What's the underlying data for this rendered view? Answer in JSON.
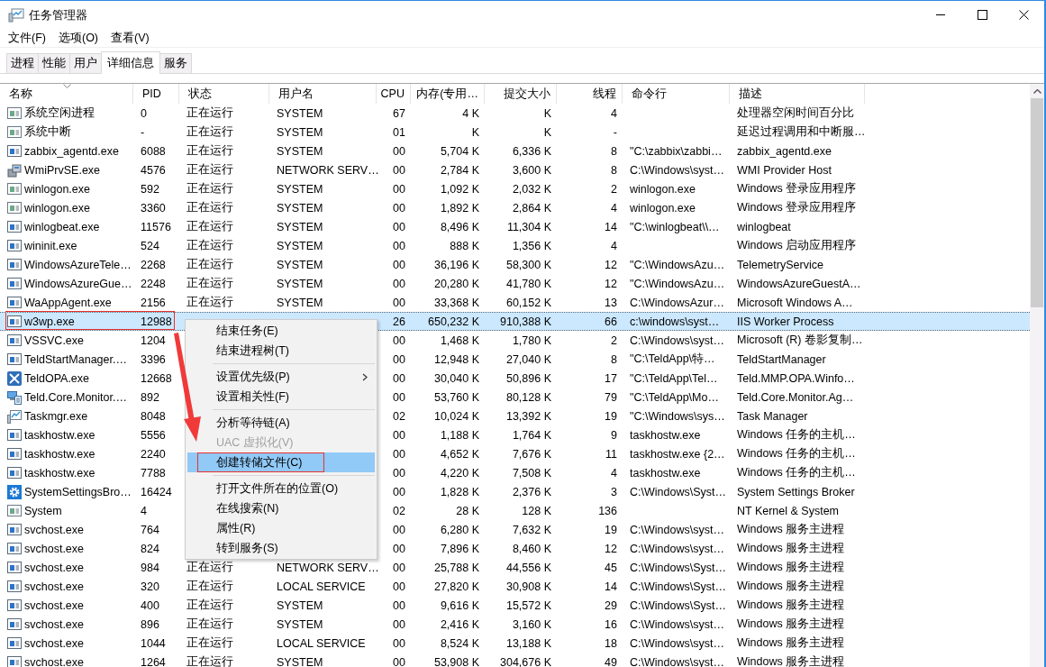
{
  "window": {
    "title": "任务管理器",
    "controls": [
      {
        "kind": "minimize"
      },
      {
        "kind": "maximize"
      },
      {
        "kind": "close"
      }
    ]
  },
  "menu_bar": [
    "文件(F)",
    "选项(O)",
    "查看(V)"
  ],
  "tabs": [
    {
      "label": "进程",
      "selected": false
    },
    {
      "label": "性能",
      "selected": false
    },
    {
      "label": "用户",
      "selected": false
    },
    {
      "label": "详细信息",
      "selected": true
    },
    {
      "label": "服务",
      "selected": false
    }
  ],
  "table": {
    "columns": [
      {
        "label": "名称",
        "sorted": true
      },
      {
        "label": "PID",
        "sorted": false
      },
      {
        "label": "状态",
        "sorted": false
      },
      {
        "label": "用户名",
        "sorted": false
      },
      {
        "label": "CPU",
        "sorted": false
      },
      {
        "label": "内存(专用…",
        "sorted": false
      },
      {
        "label": "提交大小",
        "sorted": false
      },
      {
        "label": "线程",
        "sorted": false
      },
      {
        "label": "命令行",
        "sorted": false
      },
      {
        "label": "描述",
        "sorted": false
      }
    ],
    "rows": [
      {
        "kind": "system",
        "name": "系统空闲进程",
        "pid": "0",
        "status": "正在运行",
        "user": "SYSTEM",
        "cpu": "67",
        "memory": "4 K",
        "commit": "K",
        "threads": "4",
        "description": "处理器空闲时间百分比",
        "selected": false,
        "outlined": false
      },
      {
        "kind": "system",
        "name": "系统中断",
        "pid": "-",
        "status": "正在运行",
        "user": "SYSTEM",
        "cpu": "01",
        "memory": "K",
        "commit": "K",
        "threads": "-",
        "description": "延迟过程调用和中断服…",
        "selected": false,
        "outlined": false
      },
      {
        "kind": "app",
        "name": "zabbix_agentd.exe",
        "pid": "6088",
        "status": "正在运行",
        "user": "SYSTEM",
        "cpu": "00",
        "memory": "5,704 K",
        "commit": "6,336 K",
        "threads": "8",
        "command": "\"C:\\zabbix\\zabbi…",
        "description": "zabbix_agentd.exe",
        "selected": false,
        "outlined": false
      },
      {
        "kind": "wmi",
        "name": "WmiPrvSE.exe",
        "pid": "4576",
        "status": "正在运行",
        "user": "NETWORK SERV…",
        "cpu": "00",
        "memory": "2,784 K",
        "commit": "3,600 K",
        "threads": "8",
        "command": "C:\\Windows\\syst…",
        "description": "WMI Provider Host",
        "selected": false,
        "outlined": false
      },
      {
        "kind": "system",
        "name": "winlogon.exe",
        "pid": "592",
        "status": "正在运行",
        "user": "SYSTEM",
        "cpu": "00",
        "memory": "1,092 K",
        "commit": "2,032 K",
        "threads": "2",
        "command": "winlogon.exe",
        "description": "Windows 登录应用程序",
        "selected": false,
        "outlined": false
      },
      {
        "kind": "system",
        "name": "winlogon.exe",
        "pid": "3360",
        "status": "正在运行",
        "user": "SYSTEM",
        "cpu": "00",
        "memory": "1,892 K",
        "commit": "2,864 K",
        "threads": "4",
        "command": "winlogon.exe",
        "description": "Windows 登录应用程序",
        "selected": false,
        "outlined": false
      },
      {
        "kind": "app",
        "name": "winlogbeat.exe",
        "pid": "11576",
        "status": "正在运行",
        "user": "SYSTEM",
        "cpu": "00",
        "memory": "8,496 K",
        "commit": "11,304 K",
        "threads": "14",
        "command": "\"C:\\winlogbeat\\\\…",
        "description": "winlogbeat",
        "selected": false,
        "outlined": false
      },
      {
        "kind": "app",
        "name": "wininit.exe",
        "pid": "524",
        "status": "正在运行",
        "user": "SYSTEM",
        "cpu": "00",
        "memory": "888 K",
        "commit": "1,356 K",
        "threads": "4",
        "description": "Windows 启动应用程序",
        "selected": false,
        "outlined": false
      },
      {
        "kind": "app",
        "name": "WindowsAzureTele…",
        "pid": "2268",
        "status": "正在运行",
        "user": "SYSTEM",
        "cpu": "00",
        "memory": "36,196 K",
        "commit": "58,300 K",
        "threads": "12",
        "command": "\"C:\\WindowsAzu…",
        "description": "TelemetryService",
        "selected": false,
        "outlined": false
      },
      {
        "kind": "app",
        "name": "WindowsAzureGue…",
        "pid": "2248",
        "status": "正在运行",
        "user": "SYSTEM",
        "cpu": "00",
        "memory": "20,280 K",
        "commit": "41,780 K",
        "threads": "12",
        "command": "\"C:\\WindowsAzu…",
        "description": "WindowsAzureGuestA…",
        "selected": false,
        "outlined": false
      },
      {
        "kind": "app",
        "name": "WaAppAgent.exe",
        "pid": "2156",
        "status": "正在运行",
        "user": "SYSTEM",
        "cpu": "00",
        "memory": "33,368 K",
        "commit": "60,152 K",
        "threads": "13",
        "command": "C:\\WindowsAzur…",
        "description": "Microsoft Windows A…",
        "selected": false,
        "outlined": false
      },
      {
        "kind": "app",
        "name": "w3wp.exe",
        "pid": "12988",
        "cpu": "26",
        "memory": "650,232 K",
        "commit": "910,388 K",
        "threads": "66",
        "command": "c:\\windows\\syst…",
        "description": "IIS Worker Process",
        "selected": true,
        "outlined": true
      },
      {
        "kind": "app",
        "name": "VSSVC.exe",
        "pid": "1204",
        "cpu": "00",
        "memory": "1,468 K",
        "commit": "1,780 K",
        "threads": "2",
        "command": "C:\\Windows\\syst…",
        "description": "Microsoft (R) 卷影复制…",
        "selected": false,
        "outlined": false
      },
      {
        "kind": "app",
        "name": "TeldStartManager.…",
        "pid": "3396",
        "cpu": "00",
        "memory": "12,948 K",
        "commit": "27,040 K",
        "threads": "8",
        "command": "\"C:\\TeldApp\\特…",
        "description": "TeldStartManager",
        "selected": false,
        "outlined": false
      },
      {
        "kind": "tools",
        "name": "TeldOPA.exe",
        "pid": "12668",
        "cpu": "00",
        "memory": "30,040 K",
        "commit": "50,896 K",
        "threads": "17",
        "command": "\"C:\\TeldApp\\Tel…",
        "description": "Teld.MMP.OPA.Winfo…",
        "selected": false,
        "outlined": false
      },
      {
        "kind": "computer",
        "name": "Teld.Core.Monitor.…",
        "pid": "892",
        "cpu": "00",
        "memory": "53,760 K",
        "commit": "80,128 K",
        "threads": "79",
        "command": "\"C:\\TeldApp\\Mo…",
        "description": "Teld.Core.Monitor.Ag…",
        "selected": false,
        "outlined": false
      },
      {
        "kind": "taskmgr",
        "name": "Taskmgr.exe",
        "pid": "8048",
        "cpu": "02",
        "memory": "10,024 K",
        "commit": "13,392 K",
        "threads": "19",
        "command": "\"C:\\Windows\\sys…",
        "description": "Task Manager",
        "selected": false,
        "outlined": false
      },
      {
        "kind": "app",
        "name": "taskhostw.exe",
        "pid": "5556",
        "cpu": "00",
        "memory": "1,188 K",
        "commit": "1,764 K",
        "threads": "9",
        "command": "taskhostw.exe",
        "description": "Windows 任务的主机…",
        "selected": false,
        "outlined": false
      },
      {
        "kind": "app",
        "name": "taskhostw.exe",
        "pid": "2240",
        "cpu": "00",
        "memory": "4,652 K",
        "commit": "7,676 K",
        "threads": "11",
        "command": "taskhostw.exe {2…",
        "description": "Windows 任务的主机…",
        "selected": false,
        "outlined": false
      },
      {
        "kind": "app",
        "name": "taskhostw.exe",
        "pid": "7788",
        "cpu": "00",
        "memory": "4,220 K",
        "commit": "7,508 K",
        "threads": "4",
        "command": "taskhostw.exe",
        "description": "Windows 任务的主机…",
        "selected": false,
        "outlined": false
      },
      {
        "kind": "gear",
        "name": "SystemSettingsBro…",
        "pid": "16424",
        "cpu": "00",
        "memory": "1,828 K",
        "commit": "2,376 K",
        "threads": "3",
        "command": "C:\\Windows\\Syst…",
        "description": "System Settings Broker",
        "selected": false,
        "outlined": false
      },
      {
        "kind": "system",
        "name": "System",
        "pid": "4",
        "cpu": "02",
        "memory": "28 K",
        "commit": "128 K",
        "threads": "136",
        "description": "NT Kernel & System",
        "selected": false,
        "outlined": false
      },
      {
        "kind": "app",
        "name": "svchost.exe",
        "pid": "764",
        "cpu": "00",
        "memory": "6,280 K",
        "commit": "7,632 K",
        "threads": "19",
        "command": "C:\\Windows\\syst…",
        "description": "Windows 服务主进程",
        "selected": false,
        "outlined": false
      },
      {
        "kind": "app",
        "name": "svchost.exe",
        "pid": "824",
        "cpu": "00",
        "memory": "7,896 K",
        "commit": "8,460 K",
        "threads": "12",
        "command": "C:\\Windows\\syst…",
        "description": "Windows 服务主进程",
        "selected": false,
        "outlined": false
      },
      {
        "kind": "app",
        "name": "svchost.exe",
        "pid": "984",
        "status": "正在运行",
        "user": "NETWORK SERV…",
        "cpu": "00",
        "memory": "25,788 K",
        "commit": "44,556 K",
        "threads": "45",
        "command": "C:\\Windows\\Syst…",
        "description": "Windows 服务主进程",
        "selected": false,
        "outlined": false
      },
      {
        "kind": "app",
        "name": "svchost.exe",
        "pid": "320",
        "status": "正在运行",
        "user": "LOCAL SERVICE",
        "cpu": "00",
        "memory": "27,820 K",
        "commit": "30,908 K",
        "threads": "14",
        "command": "C:\\Windows\\Syst…",
        "description": "Windows 服务主进程",
        "selected": false,
        "outlined": false
      },
      {
        "kind": "app",
        "name": "svchost.exe",
        "pid": "400",
        "status": "正在运行",
        "user": "SYSTEM",
        "cpu": "00",
        "memory": "9,616 K",
        "commit": "15,572 K",
        "threads": "29",
        "command": "C:\\Windows\\Syst…",
        "description": "Windows 服务主进程",
        "selected": false,
        "outlined": false
      },
      {
        "kind": "app",
        "name": "svchost.exe",
        "pid": "896",
        "status": "正在运行",
        "user": "SYSTEM",
        "cpu": "00",
        "memory": "2,416 K",
        "commit": "3,160 K",
        "threads": "16",
        "command": "C:\\Windows\\syst…",
        "description": "Windows 服务主进程",
        "selected": false,
        "outlined": false
      },
      {
        "kind": "app",
        "name": "svchost.exe",
        "pid": "1044",
        "status": "正在运行",
        "user": "LOCAL SERVICE",
        "cpu": "00",
        "memory": "8,524 K",
        "commit": "13,188 K",
        "threads": "18",
        "command": "C:\\Windows\\syst…",
        "description": "Windows 服务主进程",
        "selected": false,
        "outlined": false
      },
      {
        "kind": "app",
        "name": "svchost.exe",
        "pid": "1264",
        "status": "正在运行",
        "user": "SYSTEM",
        "cpu": "00",
        "memory": "53,908 K",
        "commit": "304,676 K",
        "threads": "49",
        "command": "C:\\Windows\\syst…",
        "description": "Windows 服务主进程",
        "selected": false,
        "outlined": false
      }
    ]
  },
  "context_menu": {
    "items": [
      {
        "kind": "item",
        "label": "结束任务(E)",
        "disabled": false,
        "selected": false,
        "submenu": false,
        "outlined": false
      },
      {
        "kind": "item",
        "label": "结束进程树(T)",
        "disabled": false,
        "selected": false,
        "submenu": false,
        "outlined": false
      },
      {
        "kind": "separator"
      },
      {
        "kind": "item",
        "label": "设置优先级(P)",
        "disabled": false,
        "selected": false,
        "submenu": true,
        "outlined": false
      },
      {
        "kind": "item",
        "label": "设置相关性(F)",
        "disabled": false,
        "selected": false,
        "submenu": false,
        "outlined": false
      },
      {
        "kind": "separator"
      },
      {
        "kind": "item",
        "label": "分析等待链(A)",
        "disabled": false,
        "selected": false,
        "submenu": false,
        "outlined": false
      },
      {
        "kind": "item",
        "label": "UAC 虚拟化(V)",
        "disabled": true,
        "selected": false,
        "submenu": false,
        "outlined": false
      },
      {
        "kind": "item",
        "label": "创建转储文件(C)",
        "disabled": false,
        "selected": true,
        "submenu": false,
        "outlined": true
      },
      {
        "kind": "separator"
      },
      {
        "kind": "item",
        "label": "打开文件所在的位置(O)",
        "disabled": false,
        "selected": false,
        "submenu": false,
        "outlined": false
      },
      {
        "kind": "item",
        "label": "在线搜索(N)",
        "disabled": false,
        "selected": false,
        "submenu": false,
        "outlined": false
      },
      {
        "kind": "item",
        "label": "属性(R)",
        "disabled": false,
        "selected": false,
        "submenu": false,
        "outlined": false
      },
      {
        "kind": "item",
        "label": "转到服务(S)",
        "disabled": false,
        "selected": false,
        "submenu": false,
        "outlined": false
      }
    ]
  },
  "annotation_arrow": true
}
